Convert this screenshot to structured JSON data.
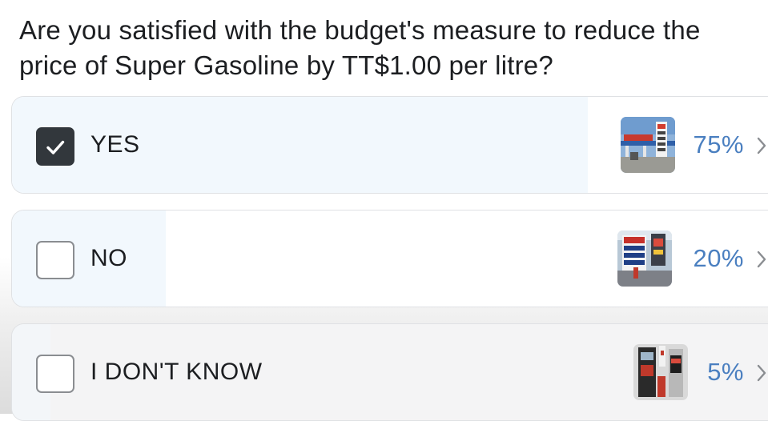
{
  "poll": {
    "question": "Are you satisfied with the budget's measure to reduce the price of Super Gasoline by TT$1.00 per litre?",
    "options": [
      {
        "label": "YES",
        "percent_text": "75%",
        "percent": 75,
        "checked": true,
        "thumbnail": "gas-station-photo"
      },
      {
        "label": "NO",
        "percent_text": "20%",
        "percent": 20,
        "checked": false,
        "thumbnail": "fuel-price-sign-photo"
      },
      {
        "label": "I DON'T KNOW",
        "percent_text": "5%",
        "percent": 5,
        "checked": false,
        "thumbnail": "fuel-pump-photo"
      }
    ],
    "colors": {
      "percent_text": "#4a7fc0",
      "result_fill": "#f2f8fd",
      "checkbox_checked": "#32373c",
      "border": "#dfe1e4"
    },
    "icons": {
      "checkbox": "checkbox-icon",
      "checkmark": "checkmark-icon",
      "chevron": "chevron-right-icon"
    }
  }
}
